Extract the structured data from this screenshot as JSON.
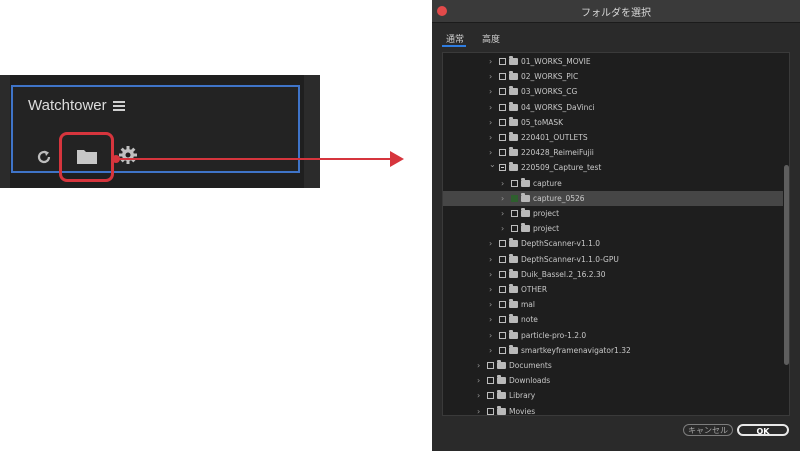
{
  "panel": {
    "title": "Watchtower",
    "highlight_color": "#d6353d",
    "frame_color": "#3f74c8",
    "icons": [
      "refresh-icon",
      "folder-icon",
      "gear-icon",
      "hamburger-menu-icon"
    ]
  },
  "dialog": {
    "title": "フォルダを選択",
    "tabs": [
      "通常",
      "高度"
    ],
    "active_tab": "通常",
    "tree": [
      {
        "label": "01_WORKS_MOVIE",
        "depth": 2,
        "check": "empty"
      },
      {
        "label": "02_WORKS_PIC",
        "depth": 2,
        "check": "empty"
      },
      {
        "label": "03_WORKS_CG",
        "depth": 2,
        "check": "empty"
      },
      {
        "label": "04_WORKS_DaVinci",
        "depth": 2,
        "check": "empty"
      },
      {
        "label": "05_toMASK",
        "depth": 2,
        "check": "empty"
      },
      {
        "label": "220401_OUTLETS",
        "depth": 2,
        "check": "empty"
      },
      {
        "label": "220428_ReimeiFujii",
        "depth": 2,
        "check": "empty"
      },
      {
        "label": "220509_Capture_test",
        "depth": 2,
        "check": "partial",
        "expanded": true
      },
      {
        "label": "capture",
        "depth": 3,
        "check": "empty"
      },
      {
        "label": "capture_0526",
        "depth": 3,
        "check": "checked",
        "selected": true
      },
      {
        "label": "project",
        "depth": 3,
        "check": "empty"
      },
      {
        "label": "project",
        "depth": 3,
        "check": "empty"
      },
      {
        "label": "DepthScanner-v1.1.0",
        "depth": 2,
        "check": "empty"
      },
      {
        "label": "DepthScanner-v1.1.0-GPU",
        "depth": 2,
        "check": "empty"
      },
      {
        "label": "Duik_Bassel.2_16.2.30",
        "depth": 2,
        "check": "empty"
      },
      {
        "label": "OTHER",
        "depth": 2,
        "check": "empty"
      },
      {
        "label": "mal",
        "depth": 2,
        "check": "empty"
      },
      {
        "label": "note",
        "depth": 2,
        "check": "empty"
      },
      {
        "label": "particle-pro-1.2.0",
        "depth": 2,
        "check": "empty"
      },
      {
        "label": "smartkeyframenavigator1.32",
        "depth": 2,
        "check": "empty"
      },
      {
        "label": "Documents",
        "depth": 1,
        "check": "empty"
      },
      {
        "label": "Downloads",
        "depth": 1,
        "check": "empty"
      },
      {
        "label": "Library",
        "depth": 1,
        "check": "empty"
      },
      {
        "label": "Movies",
        "depth": 1,
        "check": "empty"
      }
    ],
    "buttons": {
      "cancel": "キャンセル",
      "ok": "OK"
    }
  }
}
